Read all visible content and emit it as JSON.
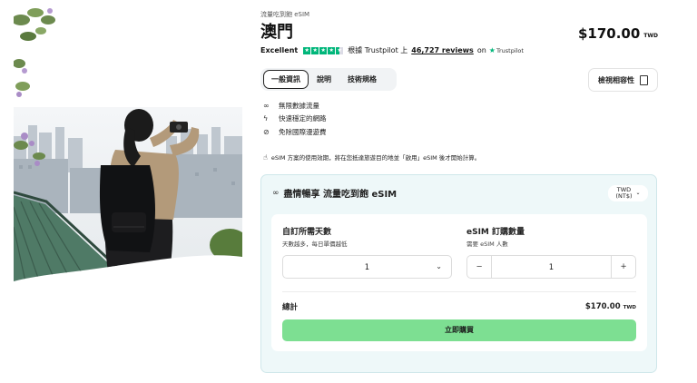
{
  "breadcrumb": "流量吃到飽 eSIM",
  "title": "澳門",
  "price": {
    "amount": "$170.00",
    "currency": "TWD"
  },
  "rating": {
    "label": "Excellent",
    "stars": 4.5,
    "via_text": "根據 Trustpilot 上",
    "reviews": "46,727 reviews",
    "on": "on",
    "provider": "Trustpilot"
  },
  "tabs": [
    "一般資訊",
    "說明",
    "技術規格"
  ],
  "compat_button": "檢視相容性",
  "features": [
    {
      "icon": "infinity-icon",
      "label": "無限數據流量"
    },
    {
      "icon": "lightning-icon",
      "label": "快速穩定的網路"
    },
    {
      "icon": "no-roaming-icon",
      "label": "免除國際漫遊費"
    }
  ],
  "note": "eSIM 方案的使用效期，將在您抵達旅遊目的地並「啟用」eSIM 後才開始計算。",
  "card": {
    "title": "盡情暢享 流量吃到飽 eSIM",
    "currency_select": {
      "line1": "TWD",
      "line2": "(NT$)"
    },
    "days_label": "自訂所需天數",
    "days_sub": "天數越多，每日單價越低",
    "days_value": "1",
    "qty_label": "eSIM 訂購數量",
    "qty_sub": "需要 eSIM 人數",
    "qty_value": "1",
    "qty_minus": "−",
    "qty_plus": "+",
    "total_label": "總計",
    "total_amount": "$170.00",
    "total_currency": "TWD",
    "buy_button": "立即購買"
  },
  "colors": {
    "trustpilot": "#00b67a",
    "buy": "#7ddf92",
    "card_bg": "#eef8f9"
  }
}
